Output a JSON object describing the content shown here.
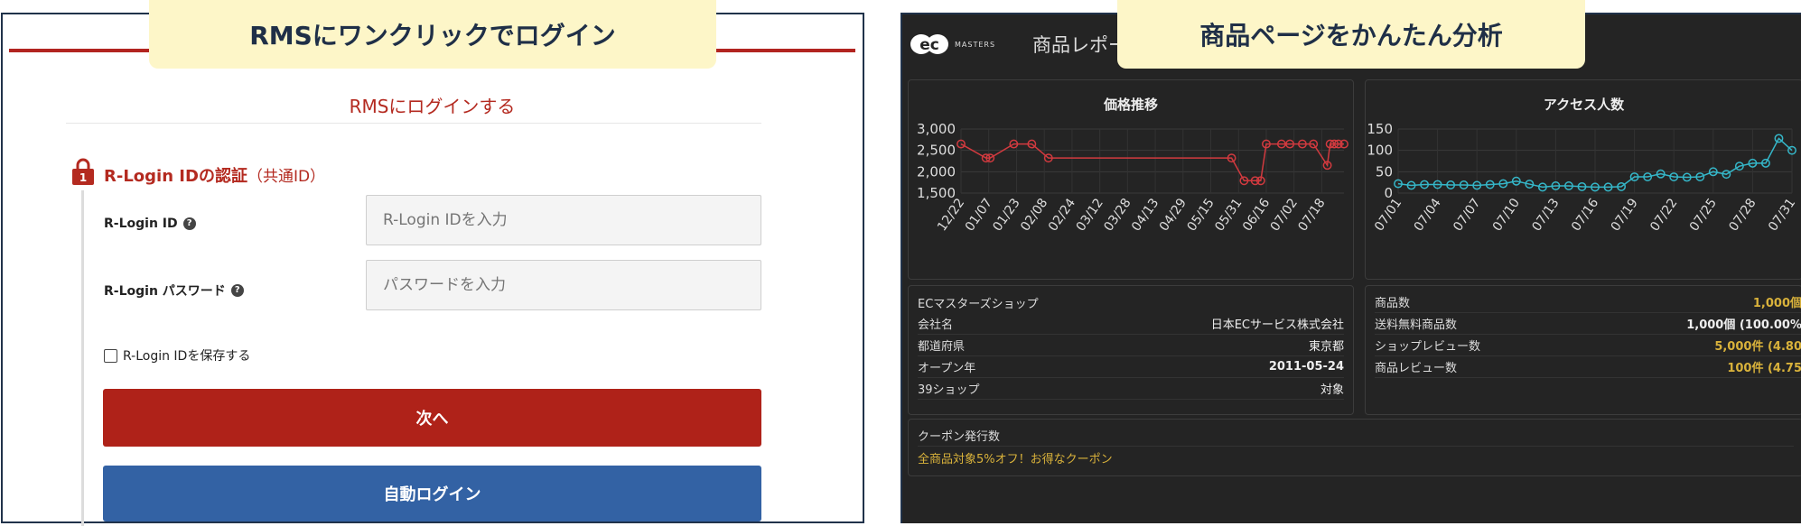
{
  "callouts": {
    "left": "RMSにワンクリックでログイン",
    "right": "商品ページをかんたん分析"
  },
  "login": {
    "rms_link": "RMSにログインする",
    "lock_number": "1",
    "auth_title": "R-Login IDの認証",
    "auth_sub": "（共通ID）",
    "id_label": "R-Login ID",
    "id_placeholder": "R-Login IDを入力",
    "password_label": "R-Login パスワード",
    "password_placeholder": "パスワードを入力",
    "help_glyph": "?",
    "save_label": "R-Login IDを保存する",
    "next_button": "次へ",
    "auto_button": "自動ログイン"
  },
  "report": {
    "logo_text": "ec",
    "logo_sub": "MASTERS",
    "title": "商品レポー",
    "price_chart_title": "価格推移",
    "access_chart_title": "アクセス人数",
    "shop_info": {
      "header": "ECマスターズショップ",
      "rows": [
        {
          "label": "会社名",
          "value": "日本ECサービス株式会社"
        },
        {
          "label": "都道府県",
          "value": "東京都"
        },
        {
          "label": "オープン年",
          "value": "2011-05-24"
        },
        {
          "label": "39ショップ",
          "value": "対象"
        }
      ]
    },
    "stats": {
      "rows": [
        {
          "label": "商品数",
          "value": "1,000個"
        },
        {
          "label": "送料無料商品数",
          "value": "1,000個 (100.00%"
        },
        {
          "label": "ショップレビュー数",
          "value": "5,000件 (4.80"
        },
        {
          "label": "商品レビュー数",
          "value": "100件 (4.75"
        }
      ]
    },
    "coupon": {
      "label": "クーポン発行数",
      "text": "全商品対象5%オフ！お得なクーポン"
    }
  },
  "chart_data": [
    {
      "type": "line",
      "title": "価格推移",
      "categories": [
        "12/22",
        "01/07",
        "01/23",
        "02/08",
        "02/24",
        "03/12",
        "03/28",
        "04/13",
        "04/29",
        "05/15",
        "05/31",
        "06/16",
        "07/02",
        "07/18"
      ],
      "series": [
        {
          "color": "#d23a3f",
          "x_index": [
            0,
            0.9,
            1.05,
            1.9,
            2.55,
            3.15,
            9.75,
            10.2,
            10.6,
            10.8,
            11.0,
            11.55,
            11.85,
            12.3,
            12.7,
            13.2,
            13.3,
            13.45,
            13.6,
            13.8
          ],
          "values": [
            2650,
            2320,
            2320,
            2650,
            2650,
            2320,
            2320,
            1790,
            1790,
            1790,
            2650,
            2650,
            2650,
            2650,
            2650,
            2150,
            2650,
            2650,
            2650,
            2650
          ]
        }
      ],
      "ylim": [
        1500,
        3000
      ],
      "yticks": [
        1500,
        2000,
        2500,
        3000
      ]
    },
    {
      "type": "line",
      "title": "アクセス人数",
      "categories": [
        "07/01",
        "07/04",
        "07/07",
        "07/10",
        "07/13",
        "07/16",
        "07/19",
        "07/22",
        "07/25",
        "07/28",
        "07/31"
      ],
      "series": [
        {
          "color": "#35b7c9",
          "values": [
            22,
            18,
            20,
            20,
            19,
            19,
            18,
            20,
            22,
            28,
            21,
            14,
            17,
            17,
            15,
            14,
            14,
            15,
            38,
            38,
            45,
            38,
            37,
            38,
            50,
            44,
            63,
            70,
            70,
            128,
            100
          ]
        }
      ],
      "ylim": [
        0,
        150
      ],
      "yticks": [
        0,
        50,
        100,
        150
      ]
    }
  ]
}
